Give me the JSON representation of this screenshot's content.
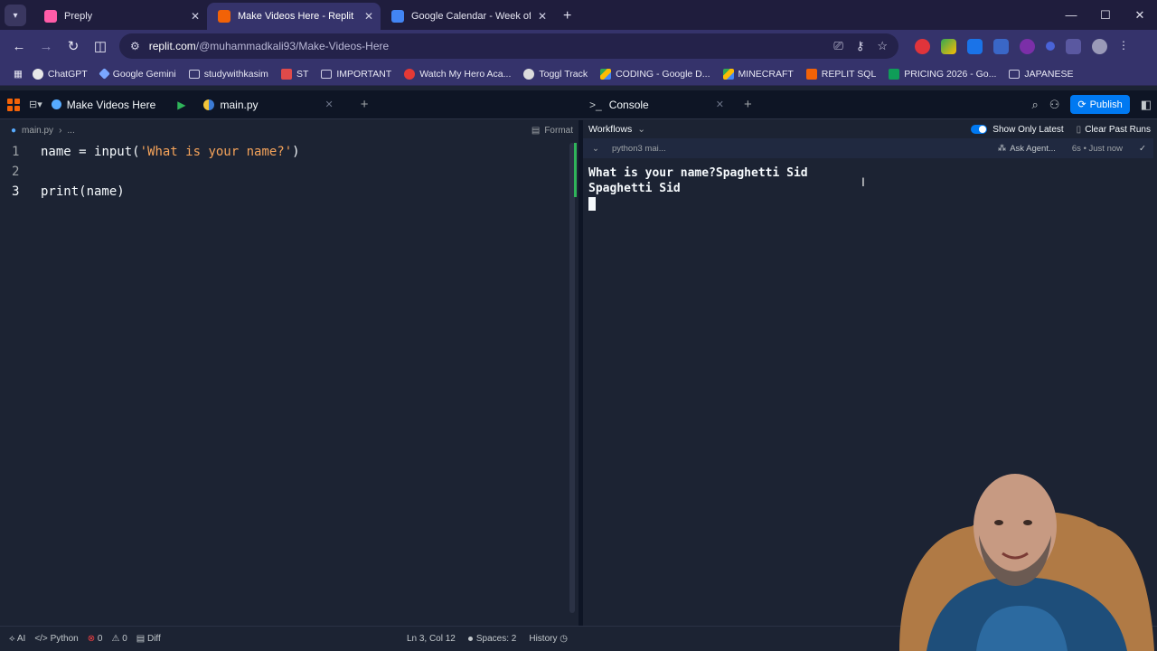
{
  "browser": {
    "tabs": [
      {
        "title": "Preply",
        "color": "#ff5ca8",
        "active": false
      },
      {
        "title": "Make Videos Here - Replit",
        "color": "#f26207",
        "active": true
      },
      {
        "title": "Google Calendar - Week of Feb",
        "color": "#4285f4",
        "active": false
      }
    ],
    "url_domain": "replit.com",
    "url_path": "/@muhammadkali93/Make-Videos-Here"
  },
  "bookmarks": [
    {
      "label": "ChatGPT",
      "icon": "chatgpt-icon"
    },
    {
      "label": "Google Gemini",
      "icon": "gemini-icon"
    },
    {
      "label": "studywithkasim",
      "icon": "folder-icon"
    },
    {
      "label": "ST",
      "icon": "st-icon"
    },
    {
      "label": "IMPORTANT",
      "icon": "folder-icon"
    },
    {
      "label": "Watch My Hero Aca...",
      "icon": "video-icon"
    },
    {
      "label": "Toggl Track",
      "icon": "toggl-icon"
    },
    {
      "label": "CODING - Google D...",
      "icon": "drive-icon"
    },
    {
      "label": "MINECRAFT",
      "icon": "drive-icon"
    },
    {
      "label": "REPLIT SQL",
      "icon": "replit-icon"
    },
    {
      "label": "PRICING 2026 - Go...",
      "icon": "sheets-icon"
    },
    {
      "label": "JAPANESE",
      "icon": "folder-icon"
    }
  ],
  "replit": {
    "project_name": "Make Videos Here",
    "file_tab": "main.py",
    "console_tab": "Console",
    "publish_label": "Publish"
  },
  "editor": {
    "breadcrumb_file": "main.py",
    "breadcrumb_more": "...",
    "format_label": "Format",
    "lines": [
      {
        "num": "1",
        "parts": [
          {
            "t": "name ",
            "c": "tok-fn"
          },
          {
            "t": "= ",
            "c": "tok-op"
          },
          {
            "t": "input(",
            "c": "tok-fn"
          },
          {
            "t": "'What is your name?'",
            "c": "tok-str"
          },
          {
            "t": ")",
            "c": "tok-fn"
          }
        ]
      },
      {
        "num": "2",
        "parts": []
      },
      {
        "num": "3",
        "parts": [
          {
            "t": "print(name)",
            "c": "tok-fn"
          }
        ]
      }
    ]
  },
  "console": {
    "workflows_label": "Workflows",
    "show_only_latest": "Show Only Latest",
    "clear_past_runs": "Clear Past Runs",
    "run_name": "python3 mai...",
    "ask_agent": "Ask Agent...",
    "run_meta": "6s • Just now",
    "output": [
      "What is your name?Spaghetti Sid",
      "Spaghetti Sid"
    ]
  },
  "status": {
    "ai": "AI",
    "language": "Python",
    "errors": "0",
    "warnings": "0",
    "diff": "Diff",
    "cursor": "Ln 3, Col 12",
    "spaces": "Spaces: 2",
    "history": "History"
  }
}
